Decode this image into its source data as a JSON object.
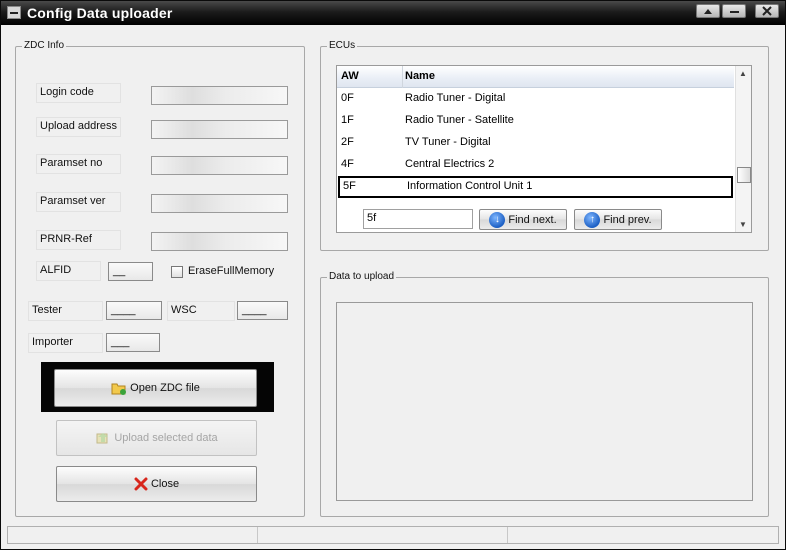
{
  "window": {
    "title": "Config Data uploader",
    "controls": {
      "minimize": "—",
      "restore": "▬",
      "close": "✕"
    }
  },
  "zdc_info": {
    "group_label": "ZDC Info",
    "login_code_label": "Login code",
    "upload_address_label": "Upload address",
    "paramset_no_label": "Paramset no",
    "paramset_ver_label": "Paramset ver",
    "prnr_ref_label": "PRNR-Ref",
    "alfid_label": "ALFID",
    "alfid_value": "__",
    "erase_full_memory_label": "EraseFullMemory",
    "tester_label": "Tester",
    "tester_value": "____",
    "wsc_label": "WSC",
    "wsc_value": "____",
    "importer_label": "Importer",
    "importer_value": "___"
  },
  "buttons": {
    "open_zdc": "Open ZDC file",
    "upload_selected": "Upload selected data",
    "close": "Close",
    "find_next": "Find next.",
    "find_prev": "Find prev."
  },
  "ecus": {
    "group_label": "ECUs",
    "columns": [
      "AW",
      "Name"
    ],
    "rows": [
      {
        "aw": "0F",
        "name": "Radio Tuner - Digital"
      },
      {
        "aw": "1F",
        "name": "Radio Tuner - Satellite"
      },
      {
        "aw": "2F",
        "name": "TV Tuner - Digital"
      },
      {
        "aw": "4F",
        "name": "Central Electrics 2"
      },
      {
        "aw": "5F",
        "name": "Information Control Unit 1"
      }
    ],
    "selected_index": 4,
    "find_value": "5f"
  },
  "data_to_upload": {
    "group_label": "Data to upload"
  },
  "icons": {
    "open_zdc": "folder-open-icon",
    "upload": "upload-icon",
    "close": "red-x-icon",
    "find_next": "arrow-down-circle-icon",
    "find_prev": "arrow-up-circle-icon"
  },
  "colors": {
    "titlebar": "#1c1c1c",
    "selection_border": "#000000",
    "close_icon": "#d8261c",
    "find_arrows": "#1c5fc4"
  }
}
